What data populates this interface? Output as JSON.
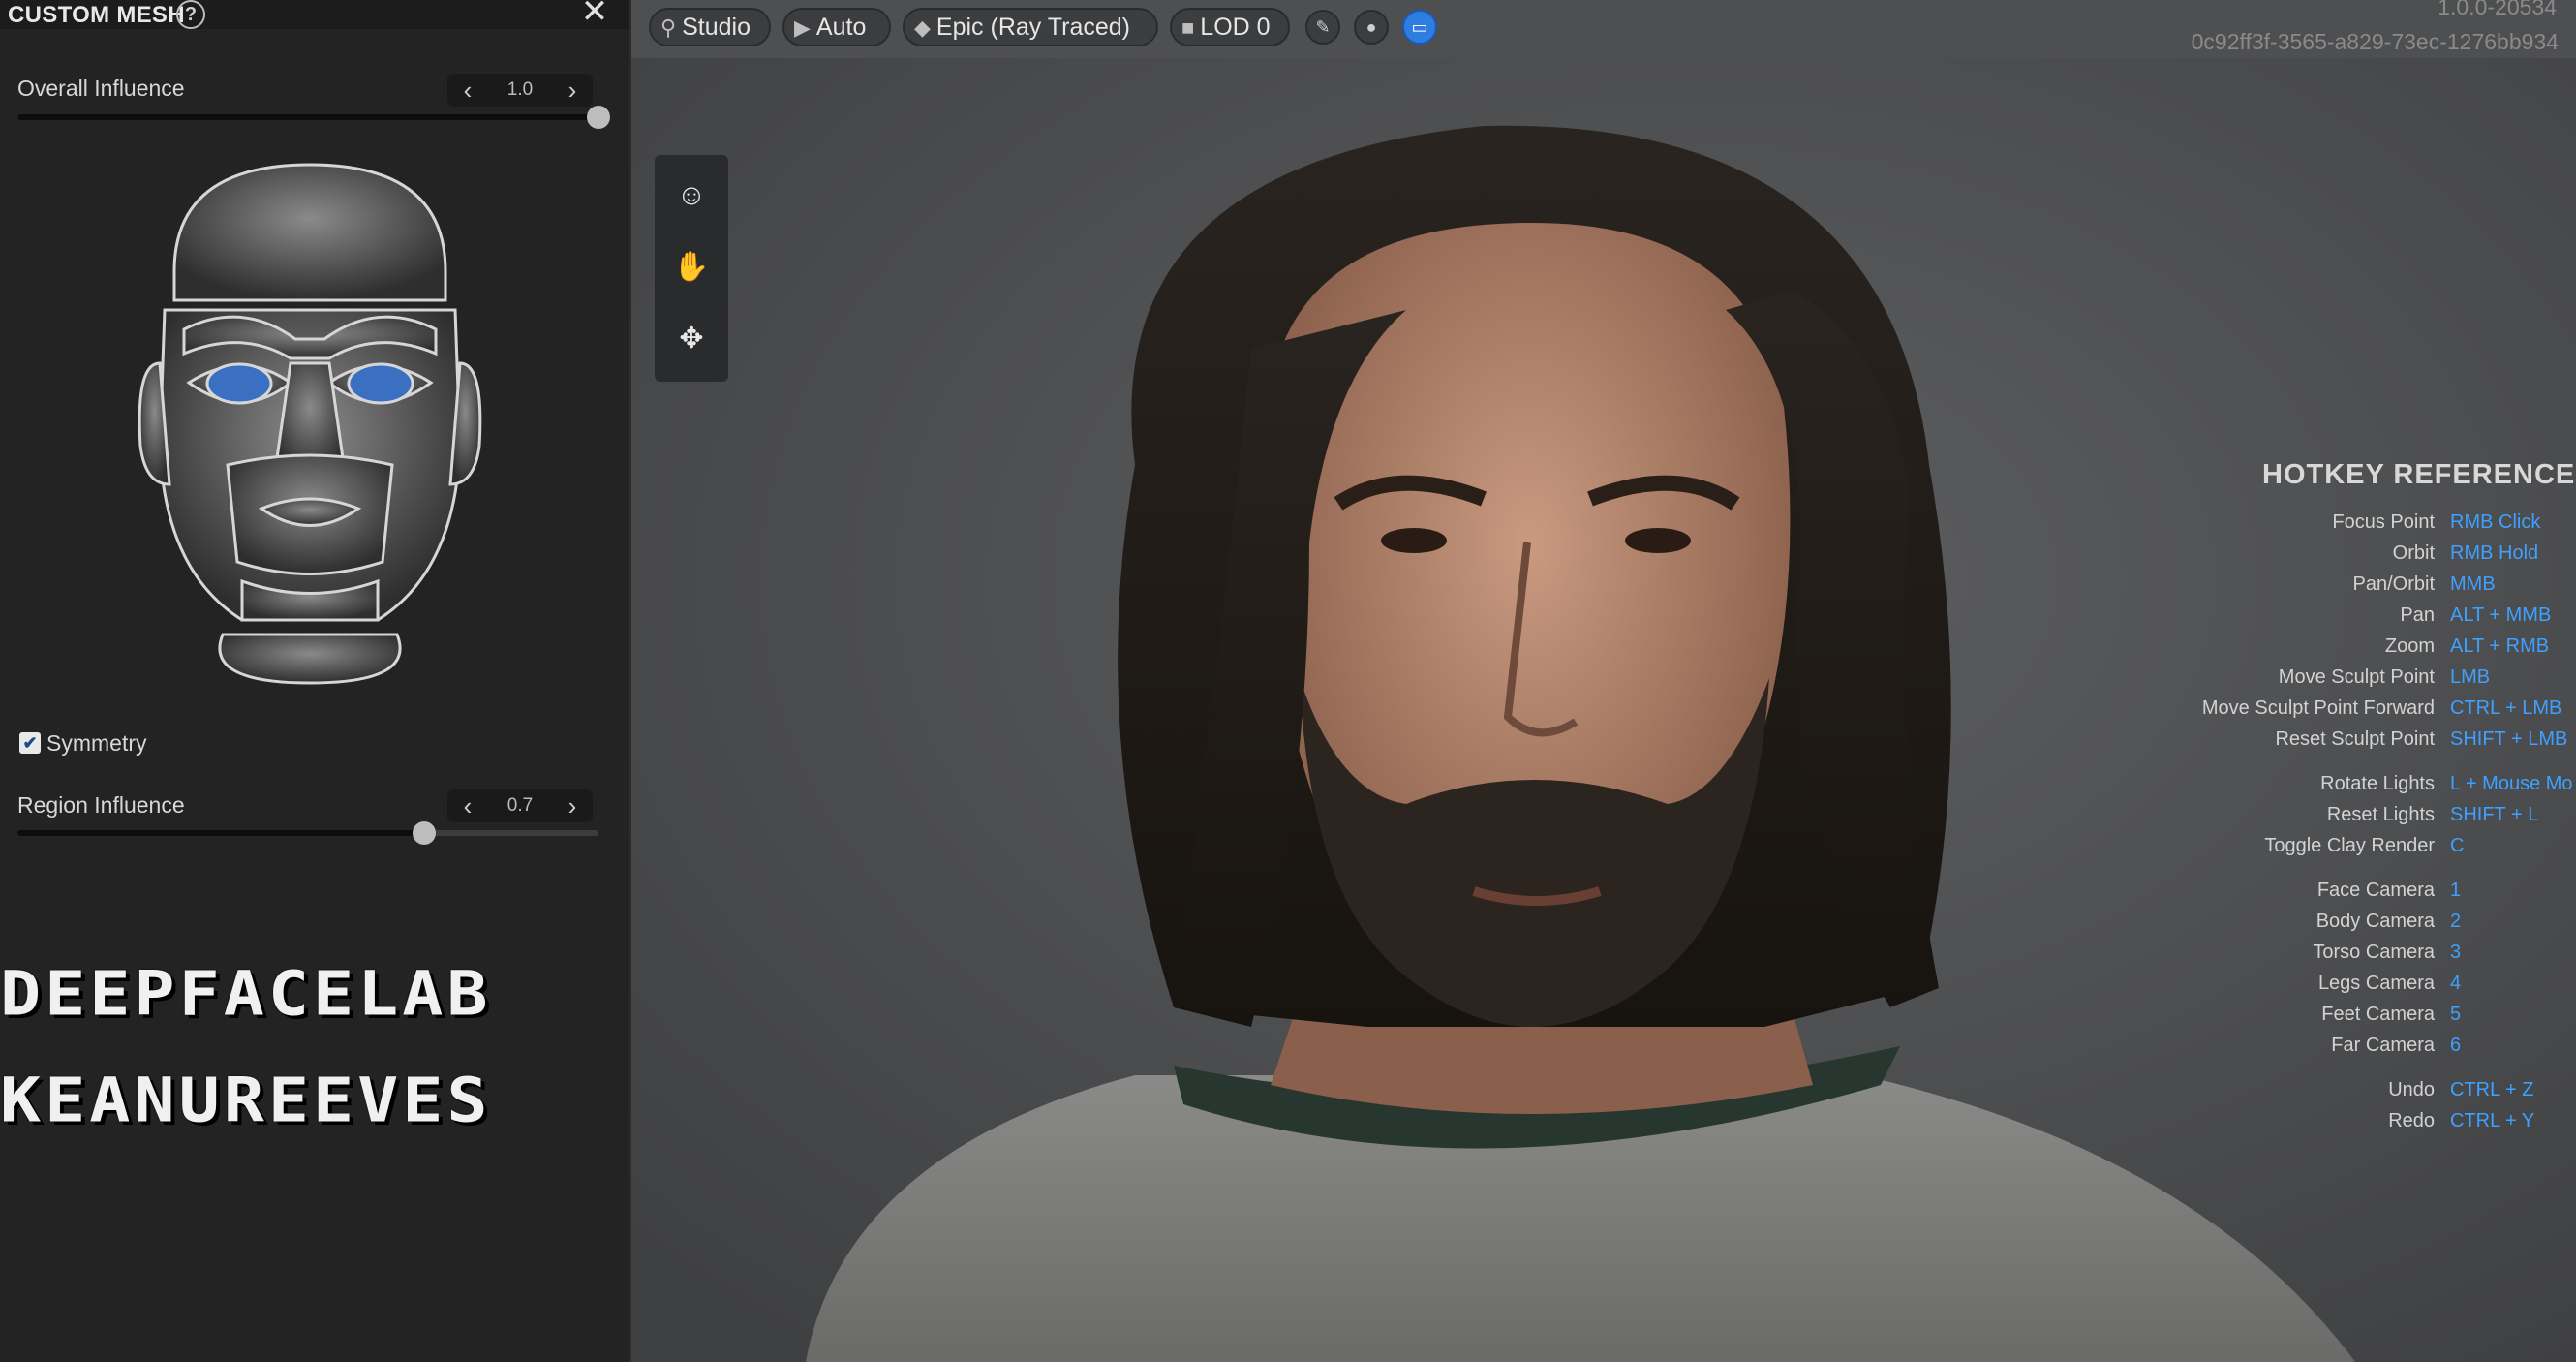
{
  "panel": {
    "title": "CUSTOM MESH",
    "help_icon": "?",
    "close_icon": "✕",
    "overall_influence": {
      "label": "Overall Influence",
      "value": "1.0",
      "level": 1.0
    },
    "symmetry": {
      "label": "Symmetry",
      "checked": true
    },
    "region_influence": {
      "label": "Region Influence",
      "value": "0.7",
      "level": 0.7
    },
    "chev_left": "‹",
    "chev_right": "›"
  },
  "overlay_text": {
    "line1": "DEEPFACELAB",
    "line2": "KEANUREEVES"
  },
  "toolbar": {
    "studio_label": "Studio",
    "auto_label": "Auto",
    "quality_label": "Epic (Ray Traced)",
    "lod_label": "LOD 0"
  },
  "build": {
    "version": "1.0.0-20534",
    "guid": "0c92ff3f-3565-a829-73ec-1276bb934"
  },
  "hotkeys": {
    "title": "HOTKEY REFERENCE",
    "items": [
      {
        "action": "Focus Point",
        "key": "RMB Click"
      },
      {
        "action": "Orbit",
        "key": "RMB Hold"
      },
      {
        "action": "Pan/Orbit",
        "key": "MMB"
      },
      {
        "action": "Pan",
        "key": "ALT + MMB"
      },
      {
        "action": "Zoom",
        "key": "ALT + RMB"
      },
      {
        "action": "Move Sculpt Point",
        "key": "LMB"
      },
      {
        "action": "Move Sculpt Point Forward",
        "key": "CTRL + LMB"
      },
      {
        "action": "Reset Sculpt Point",
        "key": "SHIFT + LMB"
      },
      {
        "action": "Rotate Lights",
        "key": "L + Mouse Mo"
      },
      {
        "action": "Reset Lights",
        "key": "SHIFT + L"
      },
      {
        "action": "Toggle Clay Render",
        "key": "C"
      },
      {
        "action": "Face Camera",
        "key": "1"
      },
      {
        "action": "Body Camera",
        "key": "2"
      },
      {
        "action": "Torso Camera",
        "key": "3"
      },
      {
        "action": "Legs Camera",
        "key": "4"
      },
      {
        "action": "Feet Camera",
        "key": "5"
      },
      {
        "action": "Far Camera",
        "key": "6"
      },
      {
        "action": "Undo",
        "key": "CTRL + Z"
      },
      {
        "action": "Redo",
        "key": "CTRL + Y"
      }
    ]
  },
  "colors": {
    "accent": "#2f7de1",
    "hotkey": "#3ea0ff",
    "eye_region": "#3a6fc2"
  },
  "icons": {
    "studio": "lightbulb-icon",
    "auto": "camera-icon",
    "quality": "diamond-icon",
    "lod": "cube-icon",
    "tool_1": "head-icon",
    "tool_2": "hand-icon",
    "tool_3": "move-icon"
  }
}
